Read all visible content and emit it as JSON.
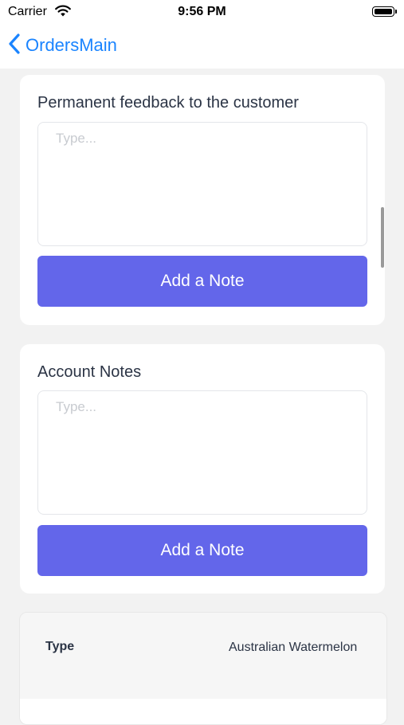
{
  "status_bar": {
    "carrier": "Carrier",
    "time": "9:56 PM"
  },
  "nav": {
    "back_label": "OrdersMain",
    "accent_color": "#1a84ff"
  },
  "cards": [
    {
      "title": "Permanent feedback to the customer",
      "input_placeholder": "Type...",
      "button_label": "Add a Note"
    },
    {
      "title": "Account Notes",
      "input_placeholder": "Type...",
      "button_label": "Add a Note"
    }
  ],
  "info": {
    "type_label": "Type",
    "type_value": "Australian Watermelon"
  },
  "colors": {
    "button": "#6366ea",
    "background": "#f2f2f2"
  }
}
